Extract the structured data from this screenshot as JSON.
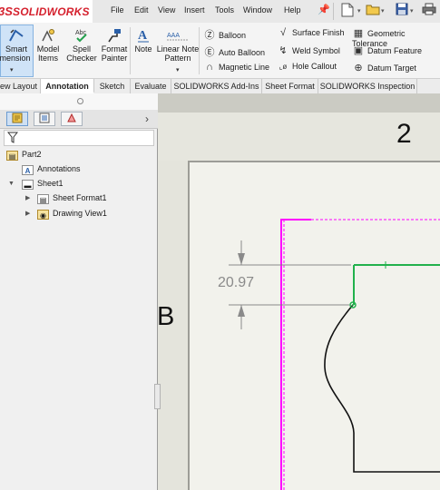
{
  "app": {
    "logo_ds": "3S",
    "logo_text": "SOLIDWORKS"
  },
  "menu": [
    "File",
    "Edit",
    "View",
    "Insert",
    "Tools",
    "Window",
    "Help"
  ],
  "ribbon": {
    "smart_dimension": {
      "line1": "Smart",
      "line2": "mension"
    },
    "model_items": {
      "line1": "Model",
      "line2": "Items"
    },
    "spell_checker": {
      "line1": "Spell",
      "line2": "Checker"
    },
    "format_painter": {
      "line1": "Format",
      "line2": "Painter"
    },
    "note": "Note",
    "linear_note_pattern": {
      "line1": "Linear Note",
      "line2": "Pattern"
    },
    "balloon": "Balloon",
    "auto_balloon": "Auto Balloon",
    "magnetic_line": "Magnetic Line",
    "surface_finish": "Surface Finish",
    "weld_symbol": "Weld Symbol",
    "hole_callout": "Hole Callout",
    "geometric_tolerance": "Geometric Tolerance",
    "datum_feature": "Datum Feature",
    "datum_target": "Datum Target"
  },
  "tabs": [
    "ew Layout",
    "Annotation",
    "Sketch",
    "Evaluate",
    "SOLIDWORKS Add-Ins",
    "Sheet Format",
    "SOLIDWORKS Inspection"
  ],
  "active_tab": "Annotation",
  "tree": {
    "root": "Part2",
    "annotations": "Annotations",
    "sheet": "Sheet1",
    "sheet_format": "Sheet Format1",
    "drawing_view": "Drawing View1"
  },
  "drawing": {
    "zone_number": "2",
    "zone_letter": "B",
    "dimension_value": "20.97"
  },
  "colors": {
    "accent": "#2a6fc9",
    "brand": "#d5212e",
    "sketch_green": "#22b14c",
    "view_border": "#ff00ff"
  }
}
